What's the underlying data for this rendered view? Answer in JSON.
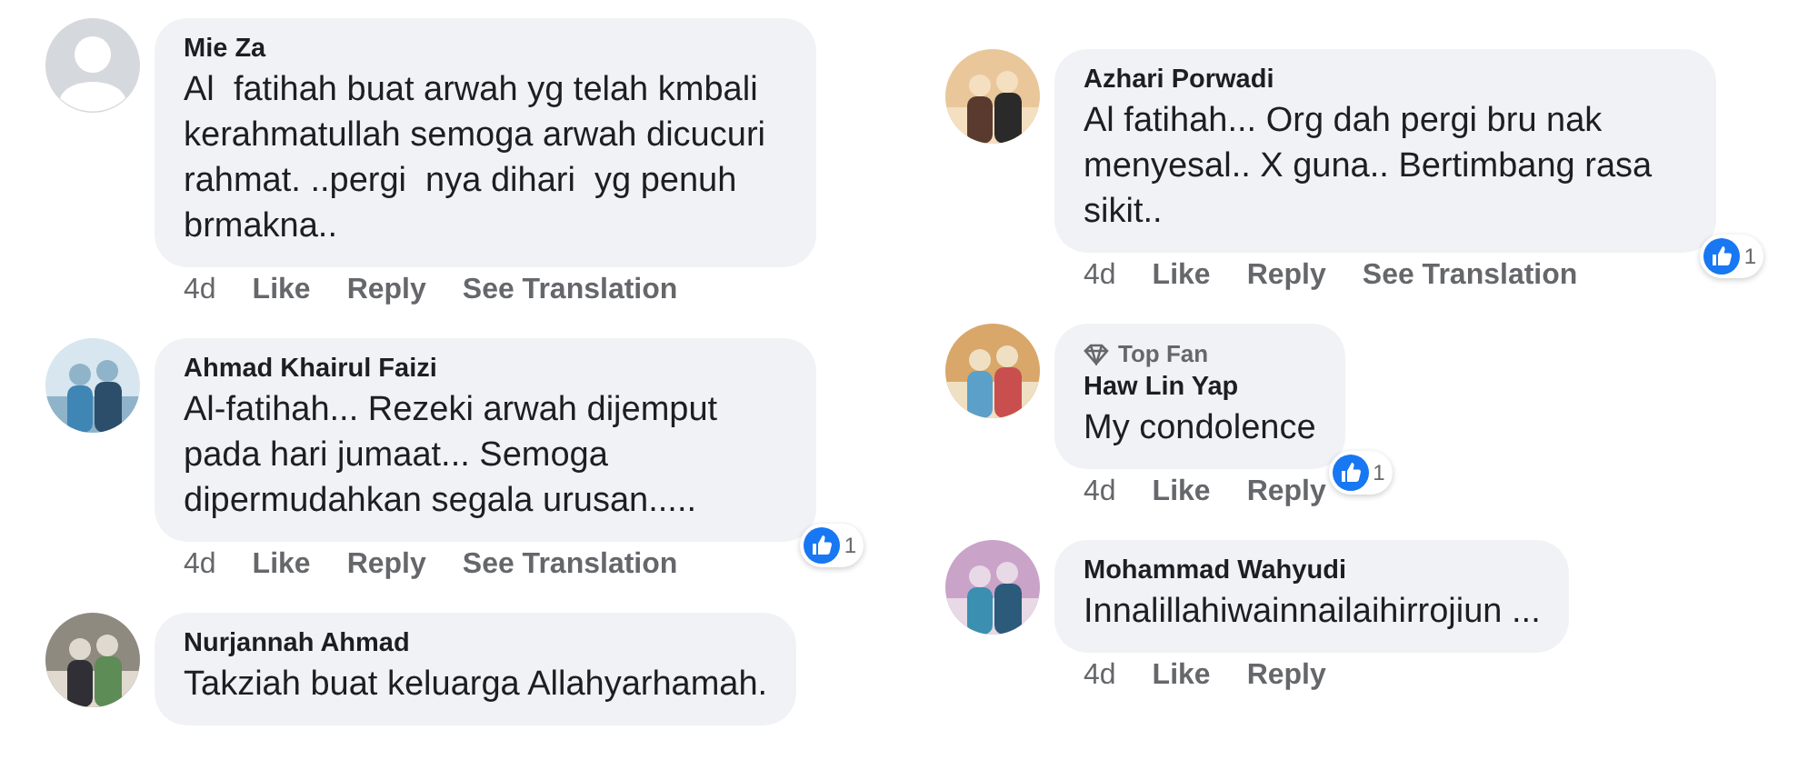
{
  "columns": [
    {
      "comments": [
        {
          "avatar": {
            "kind": "default"
          },
          "name": "Mie Za",
          "text": "Al  fatihah buat arwah yg telah kmbali kerahmatullah semoga arwah dicucuri rahmat. ..pergi  nya dihari  yg penuh brmakna..",
          "actions": {
            "time": "4d",
            "like": "Like",
            "reply": "Reply",
            "translation": "See Translation"
          }
        },
        {
          "name": "Ahmad Khairul Faizi",
          "text": "Al-fatihah... Rezeki arwah dijemput pada hari jumaat... Semoga dipermudahkan segala urusan.....",
          "actions": {
            "time": "4d",
            "like": "Like",
            "reply": "Reply",
            "translation": "See Translation"
          },
          "reactions": "1"
        },
        {
          "name": "Nurjannah Ahmad",
          "text": "Takziah buat keluarga Allahyarhamah."
        }
      ]
    },
    {
      "comments": [
        {
          "name": "Azhari Porwadi",
          "text": "Al fatihah... Org dah pergi bru nak menyesal.. X guna.. Bertimbang rasa sikit..",
          "actions": {
            "time": "4d",
            "like": "Like",
            "reply": "Reply",
            "translation": "See Translation"
          },
          "reactions": "1"
        },
        {
          "badge": "Top Fan",
          "name": "Haw Lin Yap",
          "text": "My condolence",
          "actions": {
            "time": "4d",
            "like": "Like",
            "reply": "Reply"
          },
          "reactions": "1"
        },
        {
          "name": "Mohammad Wahyudi",
          "text": "Innalillahiwainnailaihirrojiun ...",
          "actions": {
            "time": "4d",
            "like": "Like",
            "reply": "Reply"
          }
        }
      ]
    }
  ]
}
